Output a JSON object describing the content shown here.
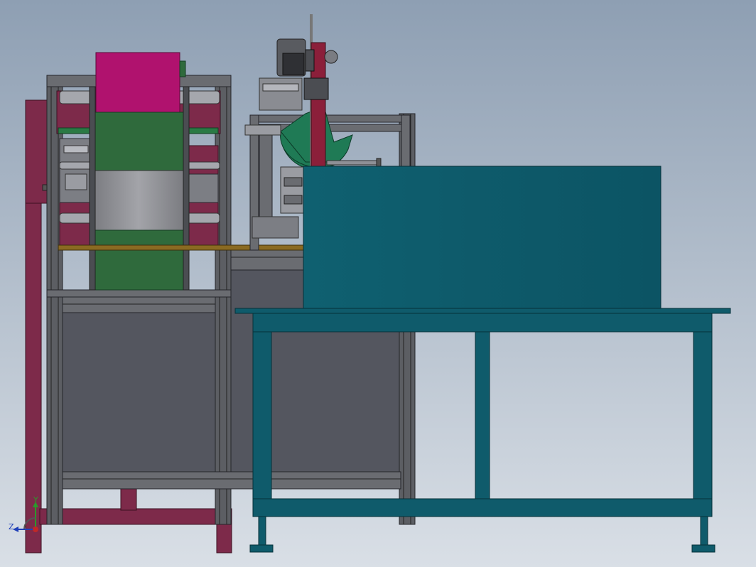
{
  "triad": {
    "y_label": "Y",
    "z_label": "Z",
    "y_color": "#2a9a2a",
    "z_color": "#1f3fb8",
    "x_color": "#c02828"
  },
  "colors": {
    "background_top": "#8e9fb3",
    "background_bottom": "#d9dfe6",
    "frame_maroon": "#7d2a4a",
    "aluminum": "#5c5e63",
    "aluminum_light": "#9a9ca2",
    "panel_dark": "#54565f",
    "roll_magenta": "#b0126e",
    "roll_green": "#2f6a3c",
    "roll_gray": "#8a8b90",
    "table_teal": "#0f5b6b",
    "box_teal": "#0d5c6c",
    "blade_green": "#1f7a55",
    "wood_strip": "#8a6a22"
  }
}
